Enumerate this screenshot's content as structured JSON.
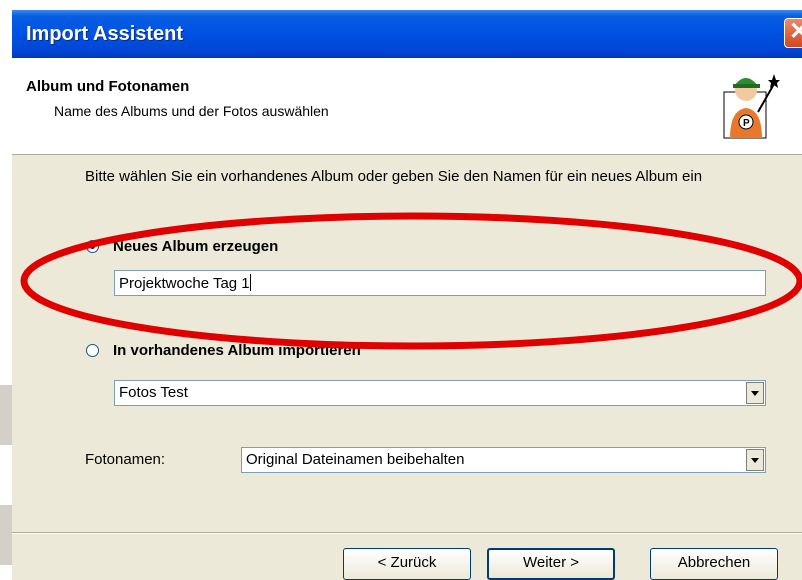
{
  "window": {
    "title": "Import Assistent",
    "close_glyph": "✕"
  },
  "header": {
    "title": "Album und Fotonamen",
    "subtitle": "Name des Albums und der Fotos auswählen",
    "image_icon": "wizard-icon"
  },
  "instruction": "Bitte wählen Sie ein vorhandenes Album oder geben Sie den Namen für ein neues Album ein",
  "new_album": {
    "label": "Neues Album erzeugen",
    "checked": true,
    "value": "Projektwoche Tag 1"
  },
  "existing_album": {
    "label": "In vorhandenes Album importieren",
    "checked": false,
    "value": "Fotos Test"
  },
  "fotonamen": {
    "label": "Fotonamen:",
    "value": "Original Dateinamen beibehalten"
  },
  "buttons": {
    "back": "< Zurück",
    "next": "Weiter >",
    "cancel": "Abbrechen"
  },
  "annotation": {
    "color": "#e00000"
  },
  "colors": {
    "titlebar": "#0055e5",
    "dialog_bg": "#ece9d8"
  }
}
